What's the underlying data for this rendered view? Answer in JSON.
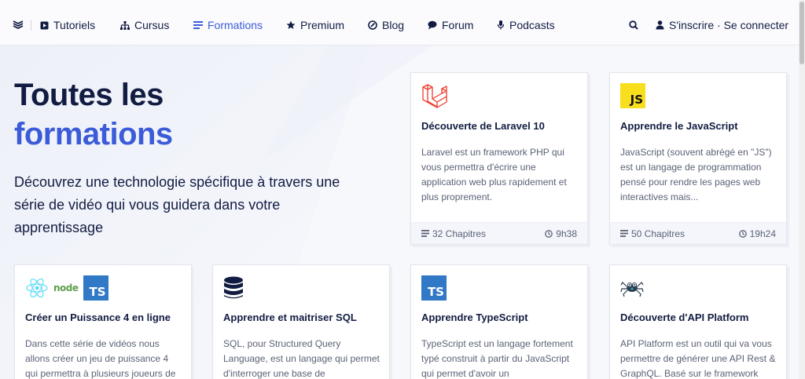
{
  "nav": {
    "items": [
      {
        "label": "Tutoriels",
        "icon": "play-square-icon"
      },
      {
        "label": "Cursus",
        "icon": "sitemap-icon"
      },
      {
        "label": "Formations",
        "icon": "list-icon",
        "active": true
      },
      {
        "label": "Premium",
        "icon": "star-icon"
      },
      {
        "label": "Blog",
        "icon": "pen-circle-icon"
      },
      {
        "label": "Forum",
        "icon": "chat-bubble-icon"
      },
      {
        "label": "Podcasts",
        "icon": "microphone-icon"
      }
    ],
    "auth_label": "S'inscrire · Se connecter"
  },
  "hero": {
    "title_line1": "Toutes les",
    "title_line2": "formations",
    "description": "Découvrez une technologie spécifique à travers une série de vidéo qui vous guidera dans votre apprentissage"
  },
  "cards": [
    {
      "title": "Découverte de Laravel 10",
      "description": "Laravel est un framework PHP qui vous permettra d'écrire une application web plus rapidement et plus proprement.",
      "chapters": "32 Chapitres",
      "duration": "9h38",
      "icon": "laravel-icon"
    },
    {
      "title": "Apprendre le JavaScript",
      "description": "JavaScript (souvent abrégé en \"JS\") est un langage de programmation pensé pour rendre les pages web interactives mais...",
      "chapters": "50 Chapitres",
      "duration": "19h24",
      "icon": "javascript-icon",
      "badge": "JS"
    },
    {
      "title": "Créer un Puissance 4 en ligne",
      "description": "Dans cette série de vidéos nous allons créer un jeu de puissance 4 qui permettra à plusieurs joueurs de",
      "icon": "react-node-typescript-icons",
      "badge": "TS",
      "node_label": "node"
    },
    {
      "title": "Apprendre et maitriser SQL",
      "description": "SQL, pour Structured Query Language, est un langage qui permet d'interroger une base de",
      "icon": "database-icon"
    },
    {
      "title": "Apprendre TypeScript",
      "description": "TypeScript est un langage fortement typé construit à partir du JavaScript qui permet d'avoir un",
      "icon": "typescript-icon",
      "badge": "TS"
    },
    {
      "title": "Découverte d'API Platform",
      "description": "API Platform est un outil qui va vous permettre de générer une API Rest & GraphQL. Basé sur le framework",
      "icon": "api-platform-spider-icon"
    }
  ],
  "colors": {
    "accent": "#3b5bd9",
    "text": "#121c42",
    "laravel": "#ef3b2d",
    "typescript": "#3178c6",
    "javascript": "#f7df1e"
  }
}
